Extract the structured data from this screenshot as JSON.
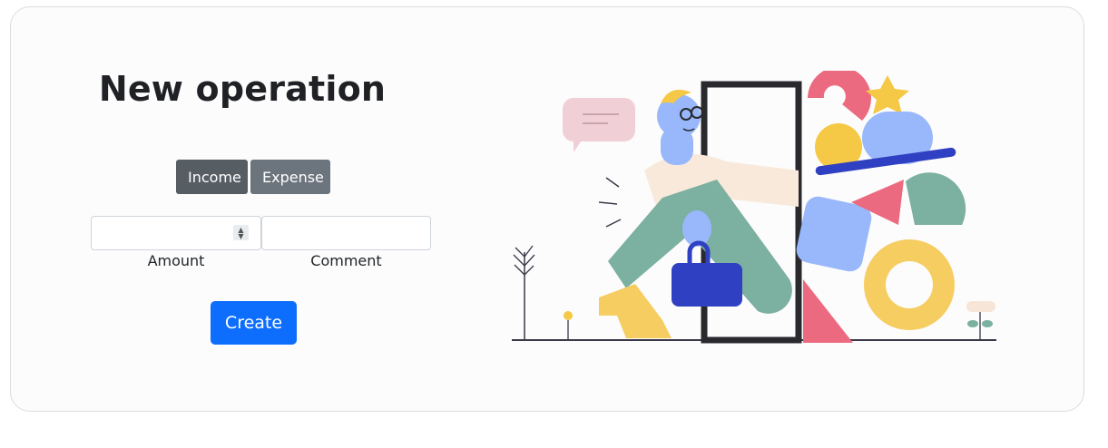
{
  "form": {
    "title": "New operation",
    "type_buttons": {
      "income": "Income",
      "expense": "Expense"
    },
    "amount": {
      "value": "",
      "label": "Amount",
      "placeholder": ""
    },
    "comment": {
      "value": "",
      "label": "Comment",
      "placeholder": ""
    },
    "submit_label": "Create"
  },
  "colors": {
    "primary": "#0d6efd",
    "income_active": "#565e64",
    "expense": "#6c757d"
  },
  "illustration": "person-stepping-through-door-with-shapes"
}
